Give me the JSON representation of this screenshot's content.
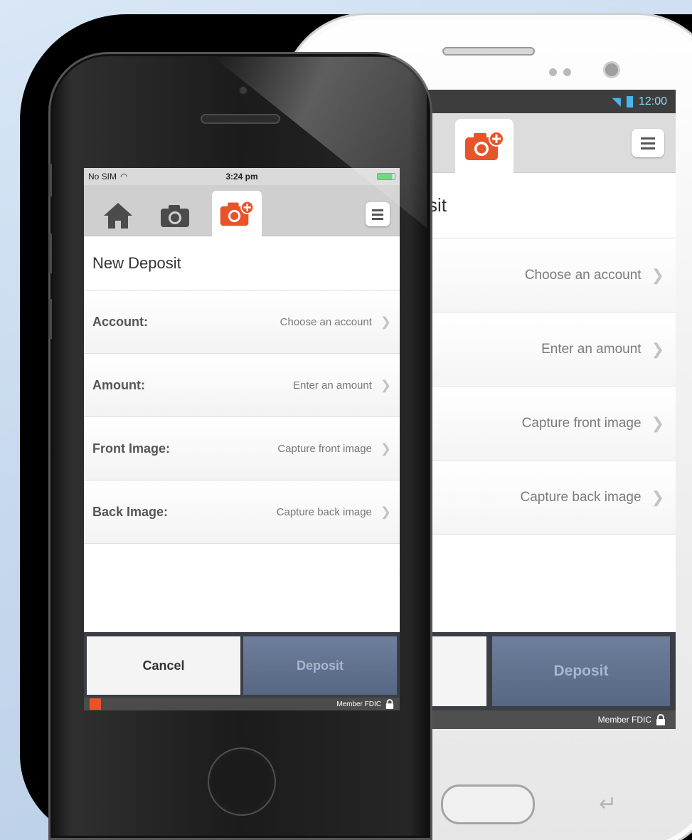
{
  "android": {
    "status": {
      "time": "12:00",
      "wifi_icon": "wifi-icon",
      "signal_icon": "signal-icon",
      "battery_icon": "battery-icon"
    },
    "active_tab_icon": "camera-plus-icon",
    "title_partial": "sit",
    "rows": [
      {
        "value": "Choose an account"
      },
      {
        "value": "Enter an amount"
      },
      {
        "value": "Capture front image"
      },
      {
        "value": "Capture back image"
      }
    ],
    "deposit_label": "Deposit",
    "footer": {
      "text": "Member FDIC",
      "icon": "lock-icon"
    }
  },
  "iphone": {
    "status": {
      "carrier": "No SIM",
      "time": "3:24 pm"
    },
    "tabs": [
      {
        "icon": "home-icon"
      },
      {
        "icon": "camera-icon"
      },
      {
        "icon": "camera-plus-icon",
        "active": true
      }
    ],
    "title": "New Deposit",
    "rows": [
      {
        "label": "Account:",
        "value": "Choose an account"
      },
      {
        "label": "Amount:",
        "value": "Enter an amount"
      },
      {
        "label": "Front Image:",
        "value": "Capture front image"
      },
      {
        "label": "Back Image:",
        "value": "Capture back image"
      }
    ],
    "cancel_label": "Cancel",
    "deposit_label": "Deposit",
    "footer": {
      "text": "Member FDIC",
      "icon": "lock-icon"
    }
  },
  "colors": {
    "accent_orange": "#e8542a",
    "bar_dark": "#3b3e45",
    "deposit_blue": "#5f7190",
    "ios_battery_green": "#4cd964"
  }
}
